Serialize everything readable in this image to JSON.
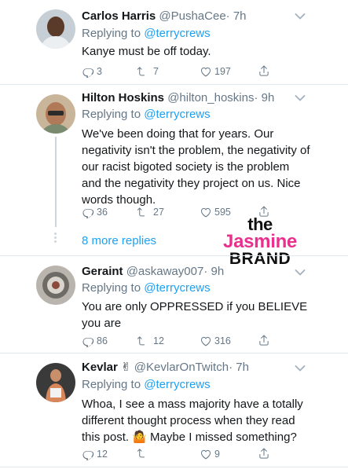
{
  "tweets": [
    {
      "name": "Carlos Harris",
      "handle": "@PushaCee",
      "time": "· 7h",
      "replying_prefix": "Replying to",
      "replying_to": "@terrycrews",
      "text": "Kanye must be off today.",
      "replies": "3",
      "retweets": "7",
      "likes": "197"
    },
    {
      "name": "Hilton Hoskins",
      "handle": "@hilton_hoskins",
      "time": "· 9h",
      "replying_prefix": "Replying to",
      "replying_to": "@terrycrews",
      "text": "We've been doing that for years. Our negativity isn't the problem, the negativity of our racist bigoted society is the problem and the negativity they project on us. Nice words though.",
      "replies": "36",
      "retweets": "27",
      "likes": "595",
      "more_replies": "8 more replies"
    },
    {
      "name": "Geraint",
      "handle": "@askaway007",
      "time": "· 9h",
      "replying_prefix": "Replying to",
      "replying_to": "@terrycrews",
      "text": "You are only OPPRESSED if you BELIEVE you are",
      "replies": "86",
      "retweets": "12",
      "likes": "316"
    },
    {
      "name": "Kevlar",
      "name_emoji": "✌",
      "handle": "@KevlarOnTwitch",
      "time": "· 7h",
      "replying_prefix": "Replying to",
      "replying_to": "@terrycrews",
      "text": "Whoa, I see a mass majority have a totally different thought process when they read this post. 🤷 Maybe I missed something?",
      "replies": "12",
      "retweets": "",
      "likes": "9"
    }
  ],
  "watermark": {
    "line1": "the",
    "line2": "Jasmine",
    "line3": "BRAND"
  },
  "colors": {
    "link": "#1da1f2",
    "secondary": "#657786",
    "divider": "#e1e8ed",
    "watermark_accent": "#e8308c"
  },
  "icons": [
    "reply-icon",
    "retweet-icon",
    "like-icon",
    "share-icon",
    "chevron-down-icon"
  ]
}
